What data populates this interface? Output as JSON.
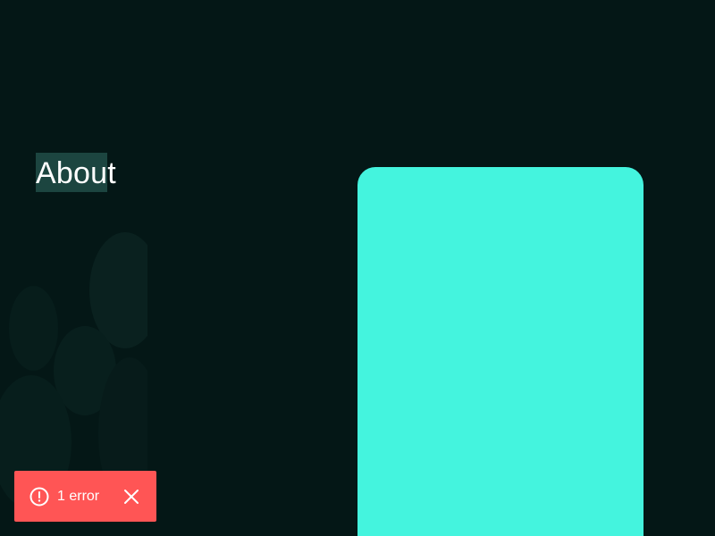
{
  "section": {
    "heading": "About"
  },
  "colors": {
    "background": "#041716",
    "accent_card": "#44f4de",
    "heading_highlight": "#1c4540",
    "error_toast": "#ff5555"
  },
  "error_toast": {
    "label": "1 error",
    "icon": "alert-circle-icon",
    "close_icon": "close-icon"
  }
}
